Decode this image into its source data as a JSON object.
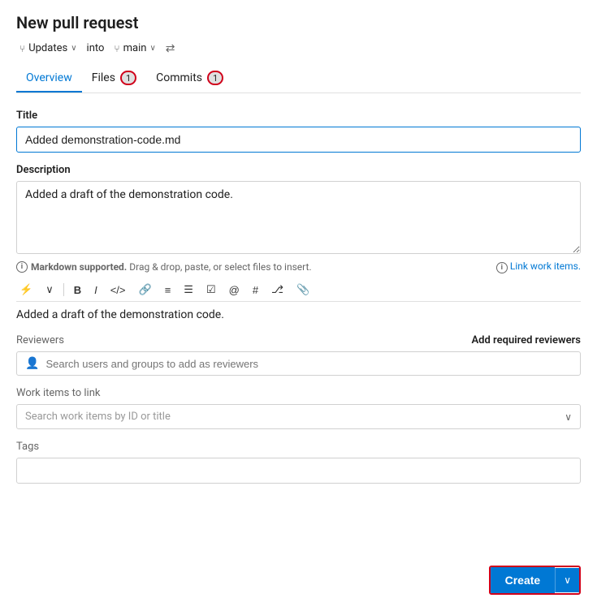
{
  "page": {
    "title": "New pull request"
  },
  "branch_row": {
    "source_icon": "⑂",
    "source_label": "Updates",
    "into_label": "into",
    "target_icon": "⑂",
    "target_label": "main",
    "swap_symbol": "⇄"
  },
  "tabs": [
    {
      "id": "overview",
      "label": "Overview",
      "active": true,
      "badge": null
    },
    {
      "id": "files",
      "label": "Files",
      "active": false,
      "badge": "1"
    },
    {
      "id": "commits",
      "label": "Commits",
      "active": false,
      "badge": "1"
    }
  ],
  "form": {
    "title_label": "Title",
    "title_value": "Added demonstration-code.md",
    "description_label": "Description",
    "description_value": "Added a draft of the demonstration code.",
    "markdown_info": "Markdown supported.",
    "drag_drop_info": "Drag & drop, paste, or select files to insert.",
    "link_work_items": "Link work items.",
    "preview_text": "Added a draft of the demonstration code.",
    "reviewers_label": "Reviewers",
    "add_reviewers_label": "Add required reviewers",
    "reviewers_placeholder": "Search users and groups to add as reviewers",
    "work_items_label": "Work items to link",
    "work_items_placeholder": "Search work items by ID or title",
    "tags_label": "Tags"
  },
  "toolbar": {
    "buttons": [
      {
        "id": "format",
        "icon": "⚡",
        "label": "format"
      },
      {
        "id": "chevron",
        "icon": "∨",
        "label": "chevron"
      },
      {
        "id": "bold",
        "icon": "B",
        "label": "bold"
      },
      {
        "id": "italic",
        "icon": "I",
        "label": "italic"
      },
      {
        "id": "code",
        "icon": "</>",
        "label": "code"
      },
      {
        "id": "link",
        "icon": "🔗",
        "label": "link"
      },
      {
        "id": "ordered-list",
        "icon": "≡",
        "label": "ordered-list"
      },
      {
        "id": "unordered-list",
        "icon": "☰",
        "label": "unordered-list"
      },
      {
        "id": "task-list",
        "icon": "☑",
        "label": "task-list"
      },
      {
        "id": "mention",
        "icon": "@",
        "label": "mention"
      },
      {
        "id": "heading",
        "icon": "#",
        "label": "heading"
      },
      {
        "id": "pr",
        "icon": "⎇",
        "label": "pr"
      },
      {
        "id": "attachment",
        "icon": "📎",
        "label": "attachment"
      }
    ]
  },
  "footer": {
    "create_label": "Create",
    "dropdown_chevron": "∨"
  },
  "colors": {
    "accent": "#0078d4",
    "border_highlight": "#d0021b"
  }
}
